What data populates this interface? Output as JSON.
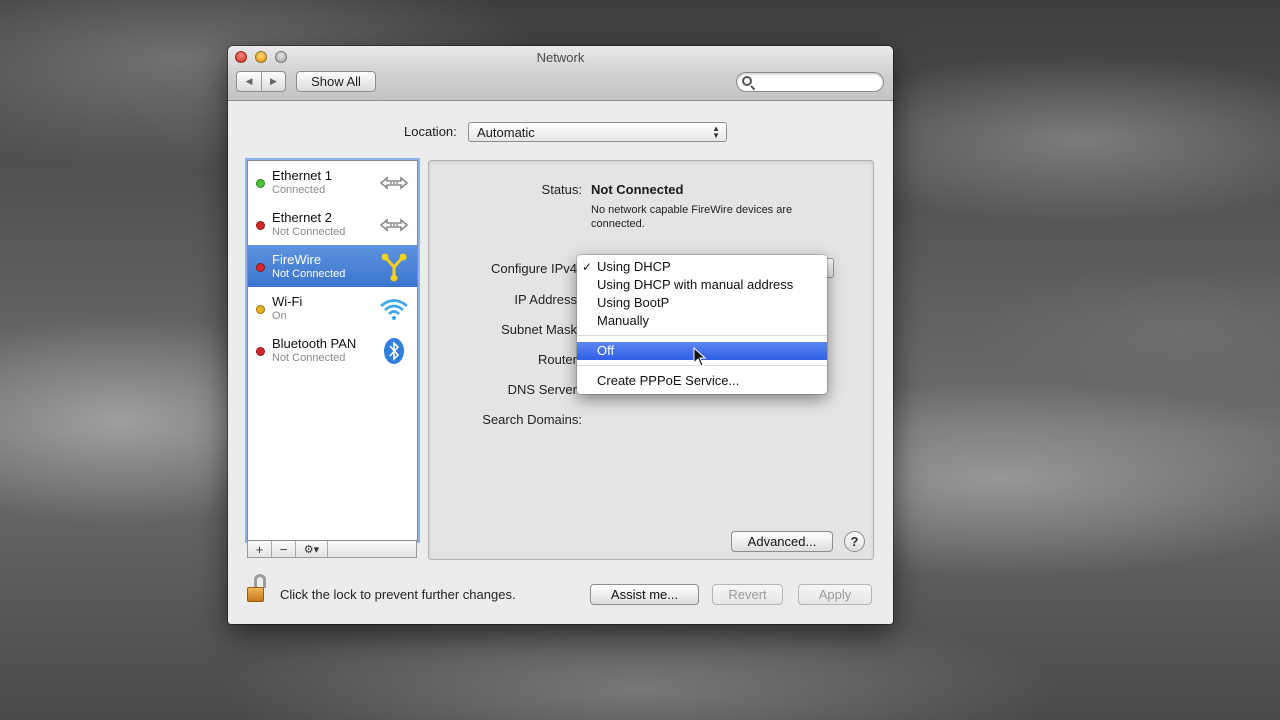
{
  "window": {
    "title": "Network"
  },
  "toolbar": {
    "back_label": "◀",
    "forward_label": "▶",
    "show_all_label": "Show All",
    "search_placeholder": ""
  },
  "location": {
    "label": "Location:",
    "value": "Automatic"
  },
  "sidebar": {
    "items": [
      {
        "name": "Ethernet 1",
        "status": "Connected",
        "dot_color": "#4cc438",
        "icon": "ethernet-arrows-icon"
      },
      {
        "name": "Ethernet 2",
        "status": "Not Connected",
        "dot_color": "#d8262a",
        "icon": "ethernet-arrows-icon"
      },
      {
        "name": "FireWire",
        "status": "Not Connected",
        "dot_color": "#d8262a",
        "icon": "firewire-icon",
        "selected": true
      },
      {
        "name": "Wi-Fi",
        "status": "On",
        "dot_color": "#e8b21f",
        "icon": "wifi-icon"
      },
      {
        "name": "Bluetooth PAN",
        "status": "Not Connected",
        "dot_color": "#d8262a",
        "icon": "bluetooth-icon"
      }
    ],
    "tools": {
      "add": "+",
      "remove": "−",
      "gear": "⚙▾"
    }
  },
  "detail": {
    "status_label": "Status:",
    "status_value": "Not Connected",
    "status_description": "No network capable FireWire devices are connected.",
    "configure_label": "Configure IPv4",
    "ip_label": "IP Address",
    "subnet_label": "Subnet Mask",
    "router_label": "Router",
    "dns_label": "DNS Server",
    "search_domains_label": "Search Domains:",
    "advanced_label": "Advanced...",
    "help_label": "?"
  },
  "menu": {
    "items": [
      "Using DHCP",
      "Using DHCP with manual address",
      "Using BootP",
      "Manually"
    ],
    "checked": "✓",
    "highlighted": "Off",
    "pppoe": "Create PPPoE Service..."
  },
  "footer": {
    "lock_text": "Click the lock to prevent further changes.",
    "assist_label": "Assist me...",
    "revert_label": "Revert",
    "apply_label": "Apply"
  },
  "colors": {
    "selection": "#3b74cf",
    "menu_highlight": "#2f5ee8"
  }
}
